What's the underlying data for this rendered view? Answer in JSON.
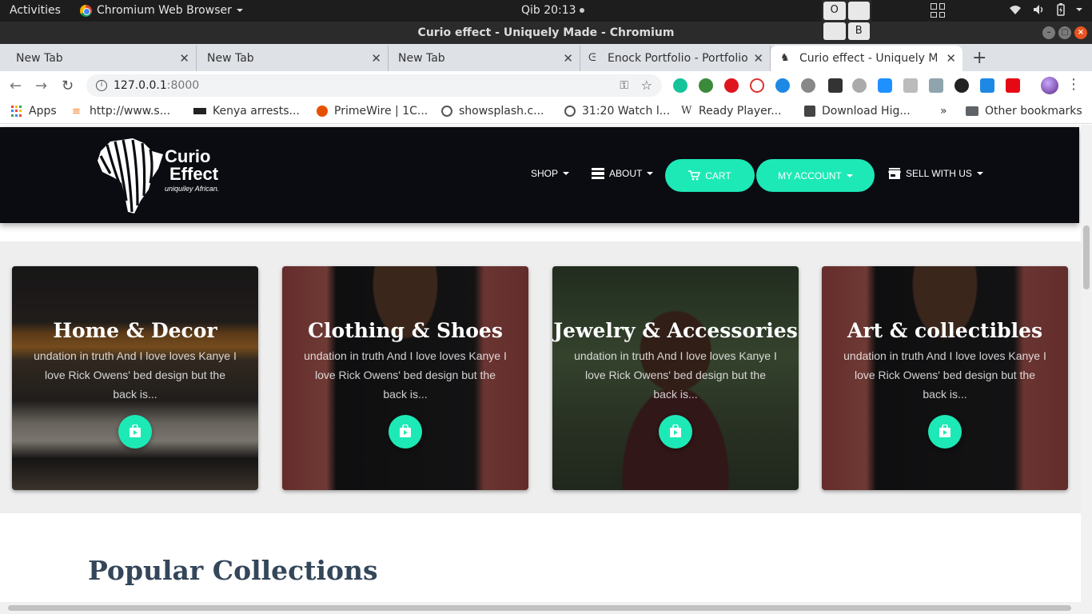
{
  "os": {
    "activities": "Activities",
    "app_name": "Chromium Web Browser",
    "clock": "Qib 20:13",
    "osk_keys": [
      "O",
      "",
      "",
      "B"
    ]
  },
  "window": {
    "title": "Curio effect - Uniquely Made - Chromium"
  },
  "tabs": [
    {
      "label": "New Tab"
    },
    {
      "label": "New Tab"
    },
    {
      "label": "New Tab"
    },
    {
      "label": "Enock Portfolio - Portfolio"
    },
    {
      "label": "Curio effect - Uniquely Made",
      "active": true
    }
  ],
  "toolbar": {
    "url_host": "127.0.0.1",
    "url_port": ":8000"
  },
  "bookmarks": [
    {
      "label": "Apps"
    },
    {
      "label": "http://www.s..."
    },
    {
      "label": "Kenya arrests..."
    },
    {
      "label": "PrimeWire | 1C..."
    },
    {
      "label": "showsplash.c..."
    },
    {
      "label": "31:20 Watch l..."
    },
    {
      "label": "Ready Player..."
    },
    {
      "label": "Download Hig..."
    },
    {
      "label": "»"
    },
    {
      "label": "Other bookmarks"
    }
  ],
  "site": {
    "logo": {
      "line1": "Curio",
      "line2": "Effect",
      "tagline": "uniquiley African."
    },
    "nav": {
      "shop": "SHOP",
      "about": "ABOUT",
      "cart": "CART",
      "account": "MY ACCOUNT",
      "sell": "SELL WITH US"
    },
    "accent": "#1de9b6",
    "categories": [
      {
        "title": "Home & Decor",
        "desc": "undation in truth And I love loves Kanye I love Rick Owens' bed design but the back is..."
      },
      {
        "title": "Clothing & Shoes",
        "desc": "undation in truth And I love loves Kanye I love Rick Owens' bed design but the back is..."
      },
      {
        "title": "Jewelry & Accessories",
        "desc": "undation in truth And I love loves Kanye I love Rick Owens' bed design but the back is..."
      },
      {
        "title": "Art & collectibles",
        "desc": "undation in truth And I love loves Kanye I love Rick Owens' bed design but the back is..."
      }
    ],
    "popular_title": "Popular Collections"
  }
}
